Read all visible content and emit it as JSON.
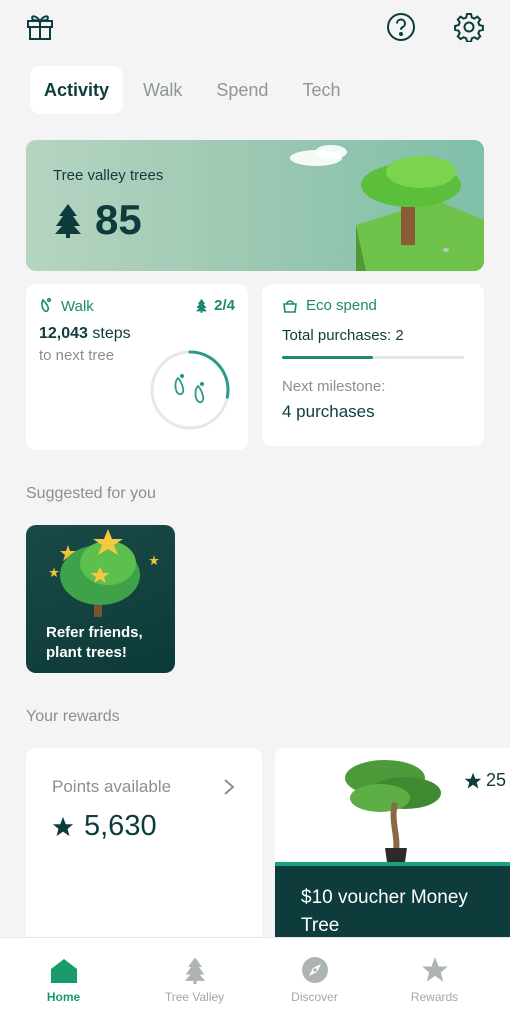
{
  "header": {
    "gift_icon": "gift-icon",
    "help_icon": "help-icon",
    "settings_icon": "gear-icon"
  },
  "tabs": [
    {
      "label": "Activity",
      "active": true
    },
    {
      "label": "Walk",
      "active": false
    },
    {
      "label": "Spend",
      "active": false
    },
    {
      "label": "Tech",
      "active": false
    }
  ],
  "hero": {
    "title": "Tree valley trees",
    "count": "85"
  },
  "walk_card": {
    "label": "Walk",
    "trees_progress": "2/4",
    "steps": "12,043",
    "steps_unit": "steps",
    "subtitle": "to next tree",
    "ring_progress": 0.28
  },
  "eco_card": {
    "label": "Eco spend",
    "total": "Total purchases: 2",
    "progress": 0.5,
    "milestone_label": "Next milestone:",
    "milestone_value": "4 purchases"
  },
  "suggested": {
    "title": "Suggested for you",
    "card_text": "Refer friends, plant trees!"
  },
  "rewards": {
    "title": "Your rewards",
    "points_label": "Points available",
    "points_value": "5,630",
    "voucher_points": "25",
    "voucher_title": "$10 voucher Money Tree"
  },
  "nav": [
    {
      "label": "Home",
      "active": true
    },
    {
      "label": "Tree Valley",
      "active": false
    },
    {
      "label": "Discover",
      "active": false
    },
    {
      "label": "Rewards",
      "active": false
    }
  ],
  "colors": {
    "accent": "#1b8a72",
    "dark": "#0e3c3c",
    "active_nav": "#1a9b6b"
  }
}
